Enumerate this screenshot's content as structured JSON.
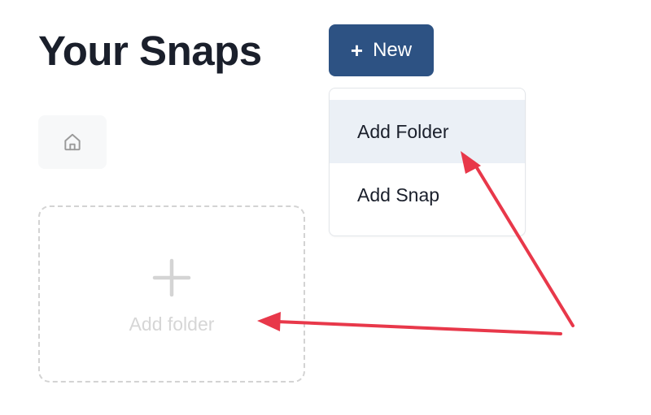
{
  "header": {
    "title": "Your Snaps",
    "new_button": {
      "icon": "plus-icon",
      "label": "New",
      "color": "#2d5283"
    }
  },
  "dropdown_menu": {
    "items": [
      {
        "label": "Add Folder",
        "highlighted": true
      },
      {
        "label": "Add Snap",
        "highlighted": false
      }
    ]
  },
  "breadcrumb": {
    "home_icon": "home-icon"
  },
  "add_folder_card": {
    "icon": "plus-icon",
    "label": "Add folder"
  },
  "annotations": {
    "arrow_color": "#e8384a",
    "arrows": [
      "arrow-to-add-folder-menu-item",
      "arrow-to-add-folder-card"
    ]
  }
}
